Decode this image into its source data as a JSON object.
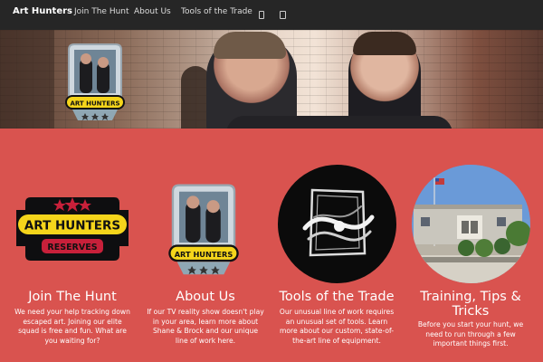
{
  "nav": {
    "brand": "Art Hunters",
    "items": [
      {
        "label": "Join The Hunt"
      },
      {
        "label": "About Us"
      },
      {
        "label": "Tools of the Trade"
      }
    ],
    "icons": [
      "phone-icon",
      "tablet-icon"
    ]
  },
  "hero": {
    "logo_text": "ART HUNTERS"
  },
  "features": [
    {
      "title": "Join The Hunt",
      "text": "We need your help tracking down escaped art. Joining our elite squad is free and fun. What are you waiting for?",
      "badge_text": "ART HUNTERS",
      "badge_sub": "RESERVES"
    },
    {
      "title": "About Us",
      "text": "If our TV reality show doesn't play in your area, learn more about Shane & Brock and our unique line of work here.",
      "badge_text": "ART HUNTERS"
    },
    {
      "title": "Tools of the Trade",
      "text": "Our unusual line of work requires an unusual set of tools. Learn more about our custom, state-of-the-art line of equipment."
    },
    {
      "title": "Training, Tips & Tricks",
      "text": "Before you start your hunt, we need to run through a few important things first."
    }
  ],
  "colors": {
    "nav_bg": "#262626",
    "page_bg": "#d9534f",
    "badge_yellow": "#f5d51b",
    "badge_red": "#c8203a"
  }
}
